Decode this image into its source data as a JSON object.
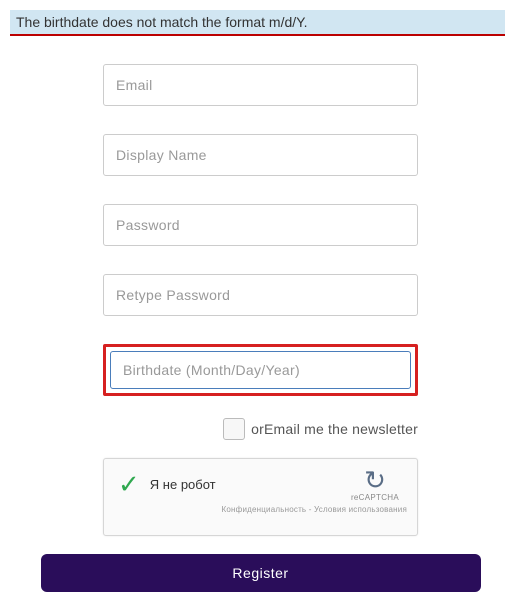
{
  "error": {
    "message": "The birthdate does not match the format m/d/Y."
  },
  "fields": {
    "email": "Email",
    "display_name": "Display Name",
    "password": "Password",
    "retype_password": "Retype Password",
    "birthdate": "Birthdate (Month/Day/Year)"
  },
  "newsletter": {
    "prefix": "or",
    "label": "Email me the newsletter"
  },
  "recaptcha": {
    "status": "Я не робот",
    "brand": "reCAPTCHA",
    "footer": "Конфиденциальность - Условия использования"
  },
  "register_label": "Register"
}
